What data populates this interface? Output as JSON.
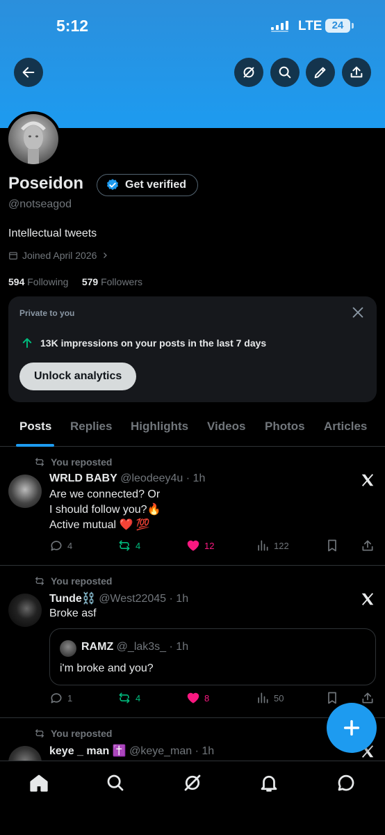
{
  "status_bar": {
    "time": "5:12",
    "carrier": "LTE",
    "battery": "24"
  },
  "header_buttons": {
    "back": "back-arrow-icon",
    "grok": "grok-icon",
    "search": "search-icon",
    "edit": "edit-icon",
    "share": "share-icon"
  },
  "profile": {
    "name": "Poseidon",
    "verify_label": "Get verified",
    "handle": "@notseagod",
    "bio": "Intellectual tweets",
    "joined": "Joined April 2026",
    "following_count": "594",
    "following_label": "Following",
    "followers_count": "579",
    "followers_label": "Followers"
  },
  "private_card": {
    "label": "Private to you",
    "impressions": "13K impressions on your posts in the last 7 days",
    "cta": "Unlock analytics"
  },
  "tabs": [
    "Posts",
    "Replies",
    "Highlights",
    "Videos",
    "Photos",
    "Articles"
  ],
  "posts": [
    {
      "repost_label": "You reposted",
      "name": "WRLD BABY",
      "handle": "@leodeey4u",
      "time": "· 1h",
      "lines": [
        "Are we connected?  Or",
        "I should follow you?🔥",
        "Active mutual ❤️ 💯"
      ],
      "replies": "4",
      "reposts": "4",
      "likes": "12",
      "views": "122"
    },
    {
      "repost_label": "You reposted",
      "name": "Tunde⛓️",
      "handle": "@West22045",
      "time": "· 1h",
      "lines": [
        "Broke asf"
      ],
      "quote": {
        "name": "RAMZ",
        "handle": "@_lak3s_",
        "time": "· 1h",
        "text": "i'm broke and you?"
      },
      "replies": "1",
      "reposts": "4",
      "likes": "8",
      "views": "50"
    },
    {
      "repost_label": "You reposted",
      "name": "keye _ man ✝️",
      "handle": "@keye_man",
      "time": "· 1h"
    }
  ],
  "colors": {
    "accent": "#1d9bf0",
    "like": "#f91880",
    "repost": "#00ba7c"
  }
}
